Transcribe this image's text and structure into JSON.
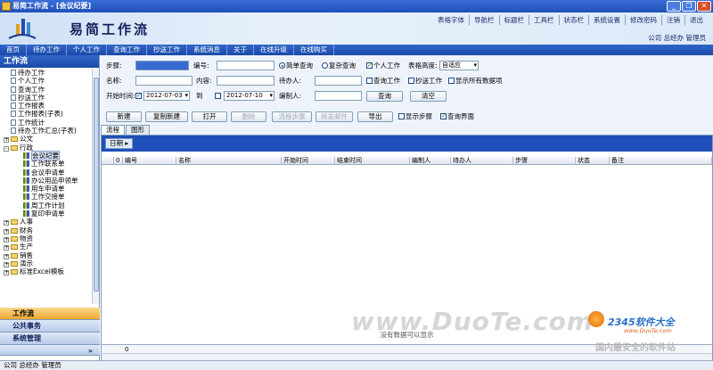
{
  "window": {
    "title": "易简工作流 - [会议纪要]"
  },
  "banner": {
    "logo_text": "易简工作流",
    "top_links": [
      "表格字体",
      "导航栏",
      "标题栏",
      "工具栏",
      "状态栏",
      "系统设置",
      "修改密码",
      "注销",
      "退出"
    ],
    "user_info": "公司 总经办 管理员"
  },
  "menubar": [
    "首页",
    "待办工作",
    "个人工作",
    "查询工作",
    "抄送工作",
    "系统消息",
    "关于",
    "在线升级",
    "在线购买"
  ],
  "sidebar": {
    "title": "工作流",
    "tree": [
      {
        "label": "待办工作",
        "icon": "doc",
        "indent": 1
      },
      {
        "label": "个人工作",
        "icon": "doc",
        "indent": 1
      },
      {
        "label": "查询工作",
        "icon": "doc",
        "indent": 1
      },
      {
        "label": "抄送工作",
        "icon": "doc",
        "indent": 1
      },
      {
        "label": "工作报表",
        "icon": "doc",
        "indent": 1
      },
      {
        "label": "工作报表(子表)",
        "icon": "doc",
        "indent": 1
      },
      {
        "label": "工作统计",
        "icon": "doc",
        "indent": 1
      },
      {
        "label": "待办工作汇总(子表)",
        "icon": "doc",
        "indent": 1
      },
      {
        "label": "公文",
        "icon": "folder",
        "indent": 0,
        "exp": "+"
      },
      {
        "label": "行政",
        "icon": "folder",
        "indent": 0,
        "exp": "-"
      },
      {
        "label": "会议纪要",
        "icon": "chart",
        "indent": 2,
        "selected": true
      },
      {
        "label": "工作联系单",
        "icon": "chart",
        "indent": 2
      },
      {
        "label": "会议申请单",
        "icon": "chart",
        "indent": 2
      },
      {
        "label": "办公用品申领单",
        "icon": "chart",
        "indent": 2
      },
      {
        "label": "用车申请单",
        "icon": "chart",
        "indent": 2
      },
      {
        "label": "工作交接单",
        "icon": "chart",
        "indent": 2
      },
      {
        "label": "周工作计划",
        "icon": "chart",
        "indent": 2
      },
      {
        "label": "复印申请单",
        "icon": "chart",
        "indent": 2
      },
      {
        "label": "人事",
        "icon": "folder",
        "indent": 0,
        "exp": "+"
      },
      {
        "label": "财务",
        "icon": "folder",
        "indent": 0,
        "exp": "+"
      },
      {
        "label": "物资",
        "icon": "folder",
        "indent": 0,
        "exp": "+"
      },
      {
        "label": "生产",
        "icon": "folder",
        "indent": 0,
        "exp": "+"
      },
      {
        "label": "销售",
        "icon": "folder",
        "indent": 0,
        "exp": "+"
      },
      {
        "label": "演示",
        "icon": "folder",
        "indent": 0,
        "exp": "+"
      },
      {
        "label": "标准Excel模板",
        "icon": "folder",
        "indent": 0,
        "exp": "+"
      }
    ],
    "nav_buttons": [
      "工作流",
      "公共事务",
      "系统管理"
    ],
    "more_icon": "double-chevron-down-icon"
  },
  "form": {
    "step_label": "步骤:",
    "number_label": "编号:",
    "simple_query": "简单查询",
    "complex_query": "复杂查询",
    "personal_work": "个人工作",
    "table_height_label": "表格高度:",
    "table_height_value": "自适应",
    "name_label": "名称:",
    "content_label": "内容:",
    "handler_label": "待办人:",
    "query_work": "查询工作",
    "copy_work": "抄送工作",
    "show_all": "显示所有数据项",
    "start_time_label": "开始时间:",
    "start_date": "2012-07-03",
    "to_label": "到",
    "end_date": "2012-07-10",
    "creator_label": "编制人:",
    "query_btn": "查询",
    "clear_btn": "清空"
  },
  "toolbar": {
    "new": "新建",
    "copy_new": "复制新建",
    "open": "打开",
    "delete": "删除",
    "flow_steps": "流程步骤",
    "send_mail": "转发邮件",
    "export": "导出",
    "show_steps": "显示步骤",
    "query_ui": "查询界面"
  },
  "tabs": [
    "流程",
    "图形"
  ],
  "grid": {
    "group_chip": "日期",
    "columns": [
      "",
      "0",
      "编号",
      "名称",
      "开始时间",
      "结束时间",
      "编制人",
      "待办人",
      "步骤",
      "状态",
      "备注"
    ],
    "empty_text": "没有数据可以显示",
    "footer_count": "0"
  },
  "statusbar": "公司 总经办 管理员",
  "watermarks": {
    "main": "www.DuoTe.com",
    "brand": "2345软件大全",
    "brand_url": "www.DuoTe.com",
    "slogan": "国内最安全的软件站"
  }
}
